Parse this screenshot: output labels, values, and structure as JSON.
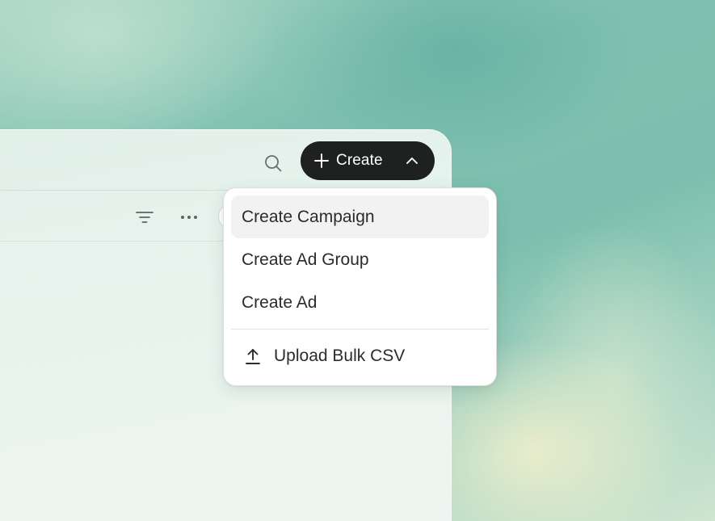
{
  "header": {
    "create_button_label": "Create",
    "icons": {
      "search": "search-icon",
      "plus": "plus-icon",
      "chevron": "chevron-up-icon"
    }
  },
  "toolbar": {
    "icons": {
      "filter": "filter-icon",
      "more": "more-horizontal-icon"
    }
  },
  "create_menu": {
    "items": [
      {
        "label": "Create Campaign",
        "highlighted": true
      },
      {
        "label": "Create Ad Group"
      },
      {
        "label": "Create Ad"
      }
    ],
    "upload": {
      "label": "Upload Bulk CSV",
      "icon": "upload-icon"
    }
  },
  "colors": {
    "button_bg": "#1f2120",
    "button_text": "#ffffff",
    "menu_hover": "#f2f2f2"
  }
}
